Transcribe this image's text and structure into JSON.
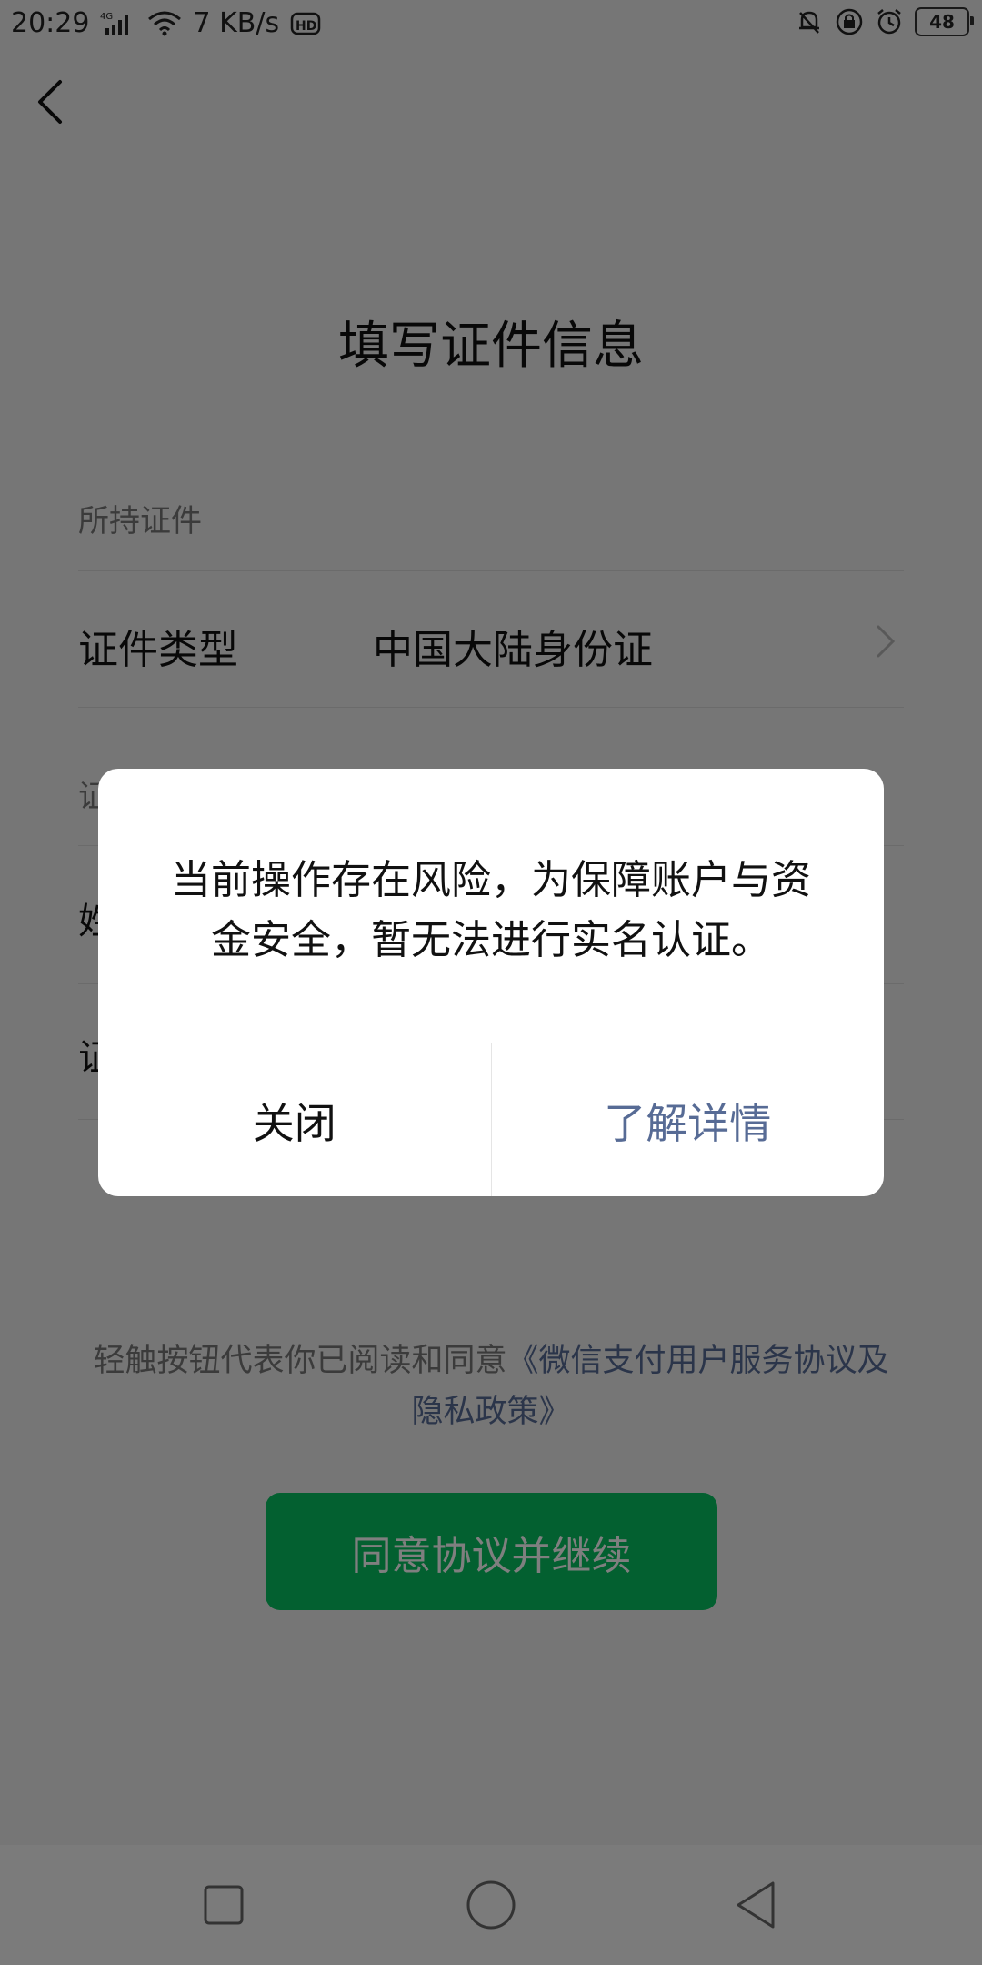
{
  "status_bar": {
    "time": "20:29",
    "network_type": "4G",
    "speed": "7 KB/s",
    "hd": "HD",
    "battery": "48",
    "icons": [
      "signal-icon",
      "wifi-icon",
      "hd-icon",
      "bell-muted-icon",
      "lock-rotation-icon",
      "alarm-icon",
      "battery-icon"
    ]
  },
  "header": {
    "back_icon": "back-icon",
    "title": "填写证件信息"
  },
  "form": {
    "section_label": "所持证件",
    "id_type_label": "证件类型",
    "id_type_value": "中国大陆身份证",
    "partial_label_1": "证",
    "partial_label_2": "姓",
    "partial_label_3": "证"
  },
  "agreement": {
    "prefix": "轻触按钮代表你已阅读和同意",
    "link": "《微信支付用户服务协议及隐私政策》"
  },
  "primary_button": {
    "label": "同意协议并继续"
  },
  "dialog": {
    "message": "当前操作存在风险，为保障账户与资金安全，暂无法进行实名认证。",
    "close_label": "关闭",
    "details_label": "了解详情"
  },
  "colors": {
    "primary_green": "#07c160",
    "link_blue": "#576b95",
    "background": "#ededed",
    "overlay": "rgba(0,0,0,0.5)"
  }
}
